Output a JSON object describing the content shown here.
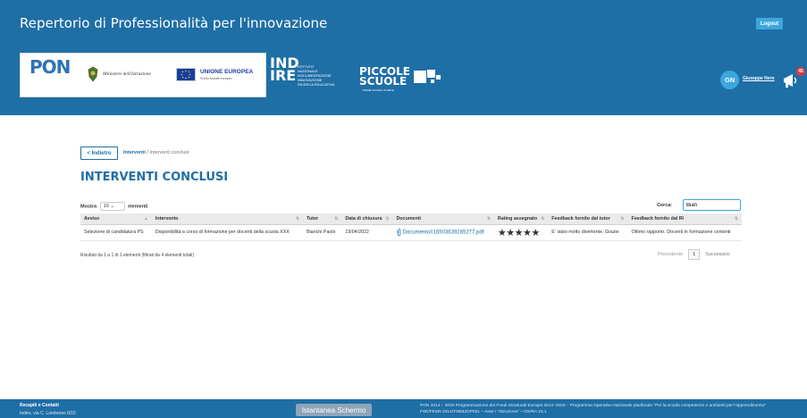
{
  "header": {
    "title": "Repertorio di Professionalità per l'innovazione",
    "logout_label": "Logout",
    "logos": {
      "pon": "PON",
      "pon_sub": "Per la scuola",
      "ministero": "Ministero dell'Istruzione",
      "eu": "UNIONE EUROPEA",
      "eu_sub": "Fondo sociale europeo",
      "indire": "IND IRE",
      "indire_desc": "ISTITUTO NAZIONALE DOCUMENTAZIONE INNOVAZIONE RICERCA EDUCATIVA",
      "piccole": "PICCOLE SCUOLE",
      "piccole_sub": "TRAME SOCIALI IN RETE"
    },
    "user": {
      "initials": "GN",
      "name": "Giuseppe Nero",
      "notif_count": "45"
    }
  },
  "nav": {
    "back_label": "< Indietro",
    "breadcrumb_link": "Interventi",
    "breadcrumb_sep": " / ",
    "breadcrumb_current": "Interventi conclusi"
  },
  "main": {
    "page_title": "INTERVENTI CONCLUSI",
    "show_prefix": "Mostra",
    "show_value": "10",
    "show_suffix": "elementi",
    "search_label": "Cerca:",
    "search_value": "Bian"
  },
  "table": {
    "columns": [
      "Avviso",
      "Intervento",
      "Tutor",
      "Data di chiusura",
      "Documenti",
      "Rating assegnato",
      "Feedback fornito dal tutor",
      "Feedback fornito dal RI"
    ],
    "rows": [
      {
        "avviso": "Selezione di candidatura PS",
        "intervento": "Disponibilità a corso di formazione per docenti della scuola XXX",
        "tutor": "Bianchi Paolo",
        "data": "19/04/2022",
        "documento": "Documento#16503639285277.pdf",
        "rating": "★★★★★",
        "feedback_tutor": "E' stato molto divertente. Grazie",
        "feedback_ri": "Ottimo rapporto. Docenti in formazione contenti"
      }
    ],
    "info": "Risultati da 1 a 1 di 1 elementi (filtrati da 4 elementi totali)",
    "pagination": {
      "prev": "Precedente",
      "current": "1",
      "next": "Successivo"
    }
  },
  "footer": {
    "contacts_title": "Recapiti e Contatti",
    "address": "Indire, via C. Lombroso 6/15",
    "screenshot_label": "Istantanea Schermo",
    "pon_text": "PON 2014 – 2020 Programmazione dei Fondi Strutturali Europei 2014–2020 – Programma Operativo Nazionale plurifondo \"Per la scuola competenze e ambienti per l'apprendimento\" FSE/FESR-2014IT05M2OP001 – Asse I \"Istruzione\" – OS/RA 10.1"
  },
  "colors": {
    "header_bg": "#1e6fa6",
    "accent": "#3ca7dc",
    "badge": "#e03a3a"
  }
}
